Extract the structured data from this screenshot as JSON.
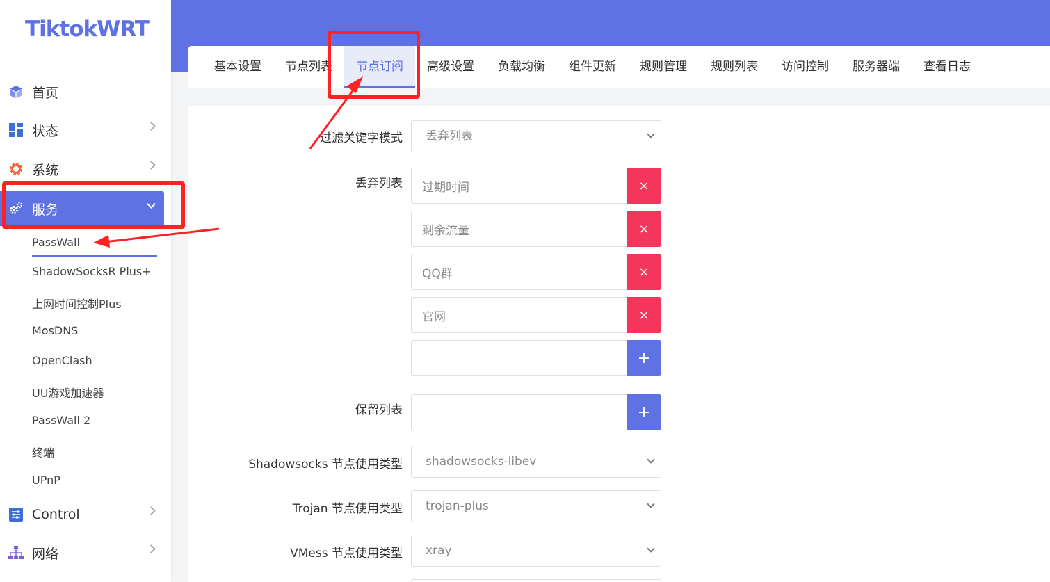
{
  "brand": {
    "logo_text": "TiktokWRT"
  },
  "sidebar": {
    "items": [
      {
        "label": "首页",
        "icon": "cube-icon",
        "has_chevron": false
      },
      {
        "label": "状态",
        "icon": "dashboard-icon",
        "has_chevron": true
      },
      {
        "label": "系统",
        "icon": "gear-icon",
        "has_chevron": true
      },
      {
        "label": "服务",
        "icon": "gears-icon",
        "has_chevron": true,
        "active": true
      },
      {
        "label": "Control",
        "icon": "sliders-icon",
        "has_chevron": true
      },
      {
        "label": "网络",
        "icon": "network-icon",
        "has_chevron": true
      }
    ],
    "services_submenu": [
      "PassWall",
      "ShadowSocksR Plus+",
      "上网时间控制Plus",
      "MosDNS",
      "OpenClash",
      "UU游戏加速器",
      "PassWall 2",
      "终端",
      "UPnP"
    ],
    "active_submenu": "PassWall"
  },
  "tabs": [
    {
      "label": "基本设置"
    },
    {
      "label": "节点列表"
    },
    {
      "label": "节点订阅",
      "active": true
    },
    {
      "label": "高级设置"
    },
    {
      "label": "负载均衡"
    },
    {
      "label": "组件更新"
    },
    {
      "label": "规则管理"
    },
    {
      "label": "规则列表"
    },
    {
      "label": "访问控制"
    },
    {
      "label": "服务器端"
    },
    {
      "label": "查看日志"
    }
  ],
  "form": {
    "filter_mode": {
      "label": "过滤关键字模式",
      "value": "丢弃列表"
    },
    "discard_list": {
      "label": "丢弃列表",
      "entries": [
        "过期时间",
        "剩余流量",
        "QQ群",
        "官网"
      ],
      "delete_symbol": "×",
      "add_symbol": "+"
    },
    "keep_list": {
      "label": "保留列表",
      "add_symbol": "+"
    },
    "ss_type": {
      "label": "Shadowsocks 节点使用类型",
      "value": "shadowsocks-libev"
    },
    "trojan_type": {
      "label": "Trojan 节点使用类型",
      "value": "trojan-plus"
    },
    "vmess_type": {
      "label": "VMess 节点使用类型",
      "value": "xray"
    }
  },
  "colors": {
    "primary": "#5e72e4",
    "danger": "#f5365c",
    "annotation": "#ff2222"
  }
}
